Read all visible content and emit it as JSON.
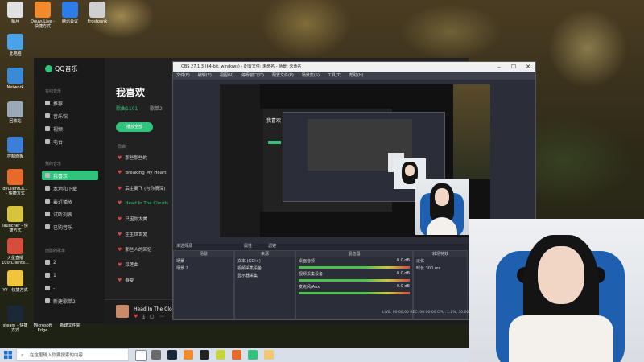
{
  "desktop": {
    "icons": [
      {
        "label": "桶月",
        "color": "#e0e0e0"
      },
      {
        "label": "DouyuLive - 快捷方式",
        "color": "#f08a2a"
      },
      {
        "label": "腾讯会议",
        "color": "#2d7de8"
      },
      {
        "label": "Frostpunk",
        "color": "#cfcfcf"
      },
      {
        "label": "此电脑",
        "color": "#4aa3e8"
      },
      {
        "label": "Network",
        "color": "#3b8ad8"
      },
      {
        "label": "回收站",
        "color": "#9aa8b8"
      },
      {
        "label": "控制面板",
        "color": "#3b7fd8"
      },
      {
        "label": "dyClientLa... - 快捷方式",
        "color": "#e86a2a"
      },
      {
        "label": "launcher - 快捷方式",
        "color": "#d8c43c"
      },
      {
        "label": "火星直播 100tCliente...",
        "color": "#d84c3c"
      },
      {
        "label": "YY - 快捷方式",
        "color": "#f0c43c"
      },
      {
        "label": "steam - 快捷方式",
        "color": "#1b2838"
      },
      {
        "label": "Microsoft Edge",
        "color": "#2e9de0"
      },
      {
        "label": "新建文件夹",
        "color": "#f0c870"
      }
    ]
  },
  "qqmusic": {
    "app_name": "QQ音乐",
    "sections": {
      "online": "在线音乐",
      "mine": "我的音乐",
      "created": "创建的歌单"
    },
    "nav_online": [
      "推荐",
      "音乐馆",
      "视频",
      "电台"
    ],
    "nav_mine": [
      "我喜欢",
      "本地和下载",
      "最近播放",
      "试听列表",
      "已购音乐"
    ],
    "created_lists": [
      "2",
      "1",
      "-",
      "新建歌单2"
    ],
    "page_title": "我喜欢",
    "tabs": [
      "歌曲1101",
      "歌单2"
    ],
    "play_all": "播放全部",
    "songs_header": "歌曲",
    "songs": [
      "那些那些的",
      "Breaking My Heart",
      "后主离飞 (与你情深)",
      "Head In The Clouds",
      "只因你太美",
      "生生世世爱",
      "那些人的回忆",
      "采莲曲",
      "春夏"
    ],
    "playing_index": 3,
    "now_playing": "Head In The Clouds"
  },
  "obs": {
    "title": "OBS 27.1.3 (64-bit, windows) - 配置文件: 未命名 - 场景: 未命名",
    "menu": [
      "文件(F)",
      "编辑(E)",
      "视图(V)",
      "停靠窗口(D)",
      "配置文件(P)",
      "场景集(S)",
      "工具(T)",
      "帮助(H)"
    ],
    "source_label": "未选择源",
    "props_btn": "属性",
    "filters_btn": "滤镜",
    "docks": {
      "scenes": {
        "title": "场景",
        "items": [
          "场景",
          "场景 2"
        ]
      },
      "sources": {
        "title": "来源",
        "items": [
          "文本 (GDI+)",
          "视频采集设备",
          "显示器采集"
        ]
      },
      "mixer": {
        "title": "混音器",
        "items": [
          "桌面音频",
          "视频采集设备",
          "麦克风/Aux"
        ],
        "db": [
          "0.0 dB",
          "0.0 dB",
          "0.0 dB"
        ]
      },
      "transitions": {
        "title": "转场特效",
        "mode": "淡化",
        "duration_label": "时长",
        "duration": "300 ms"
      }
    },
    "status": "LIVE: 00:00:00  REC: 00:00:00  CPU: 1.2%, 30.00 fps"
  },
  "taskbar": {
    "search_placeholder": "在这里输入你要搜索的内容"
  }
}
